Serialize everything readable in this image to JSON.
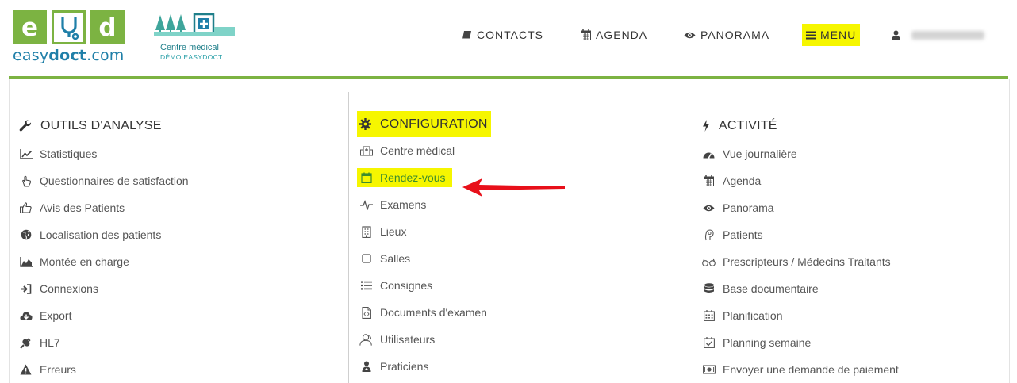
{
  "brand": {
    "tiles": [
      "e",
      "d"
    ],
    "logo_text_plain": "easy",
    "logo_text_bold": "doct",
    "logo_text_suffix": ".com",
    "clinic_name": "Centre médical",
    "clinic_subtitle": "DÉMO EASYDOCT",
    "green": "#7cb342",
    "blue": "#1f7fa8",
    "highlight": "#f6f600"
  },
  "nav": {
    "contacts": {
      "label": "CONTACTS",
      "icon": "book-icon"
    },
    "agenda": {
      "label": "AGENDA",
      "icon": "calendar-icon"
    },
    "panorama": {
      "label": "PANORAMA",
      "icon": "eye-icon"
    },
    "menu": {
      "label": "MENU",
      "icon": "bars-icon"
    },
    "user": {
      "icon": "user-icon"
    }
  },
  "columns": {
    "analysis": {
      "title": "OUTILS D'ANALYSE",
      "icon": "wrench-icon",
      "items": [
        {
          "label": "Statistiques",
          "icon": "line-chart-icon"
        },
        {
          "label": "Questionnaires de satisfaction",
          "icon": "thumb-pointer-icon"
        },
        {
          "label": "Avis des Patients",
          "icon": "thumbs-up-icon"
        },
        {
          "label": "Localisation des patients",
          "icon": "globe-icon"
        },
        {
          "label": "Montée en charge",
          "icon": "area-chart-icon"
        },
        {
          "label": "Connexions",
          "icon": "sign-in-icon"
        },
        {
          "label": "Export",
          "icon": "cloud-download-icon"
        },
        {
          "label": "HL7",
          "icon": "plug-icon"
        },
        {
          "label": "Erreurs",
          "icon": "warning-icon"
        }
      ]
    },
    "configuration": {
      "title": "CONFIGURATION",
      "icon": "gear-icon",
      "items": [
        {
          "label": "Centre médical",
          "icon": "hospital-icon"
        },
        {
          "label": "Rendez-vous",
          "icon": "calendar-icon"
        },
        {
          "label": "Examens",
          "icon": "heartbeat-icon"
        },
        {
          "label": "Lieux",
          "icon": "building-icon"
        },
        {
          "label": "Salles",
          "icon": "square-icon"
        },
        {
          "label": "Consignes",
          "icon": "list-icon"
        },
        {
          "label": "Documents d'examen",
          "icon": "file-icon"
        },
        {
          "label": "Utilisateurs",
          "icon": "users-icon"
        },
        {
          "label": "Praticiens",
          "icon": "doctor-icon"
        }
      ]
    },
    "activity": {
      "title": "ACTIVITÉ",
      "icon": "bolt-icon",
      "items": [
        {
          "label": "Vue journalière",
          "icon": "dashboard-icon"
        },
        {
          "label": "Agenda",
          "icon": "calendar-icon"
        },
        {
          "label": "Panorama",
          "icon": "eye-icon"
        },
        {
          "label": "Patients",
          "icon": "patient-icon"
        },
        {
          "label": "Prescripteurs / Médecins Traitants",
          "icon": "glasses-icon"
        },
        {
          "label": "Base documentaire",
          "icon": "database-icon"
        },
        {
          "label": "Planification",
          "icon": "calendar-grid-icon"
        },
        {
          "label": "Planning semaine",
          "icon": "calendar-check-icon"
        },
        {
          "label": "Envoyer une demande de paiement",
          "icon": "money-icon"
        }
      ]
    }
  }
}
